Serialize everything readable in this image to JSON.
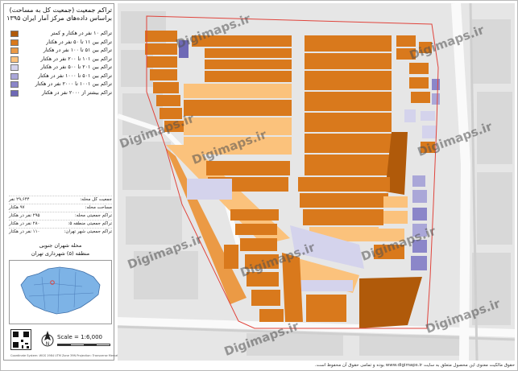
{
  "panel": {
    "title_line1": "تراکم جمعیت (جمعیت کل به مساحت)",
    "title_line2": "براساس داده‌های مرکز آمار ایران ۱۳۹۵"
  },
  "legend": [
    {
      "label": "تراکم ۱۰ نفر در هکتار و کمتر",
      "color": "#b05a0a"
    },
    {
      "label": "تراکم بین ۱۱ تا ۵۰ نفر در هکتار",
      "color": "#d9791c"
    },
    {
      "label": "تراکم بین ۵۱ تا ۱۰۰ نفر در هکتار",
      "color": "#eb9a45"
    },
    {
      "label": "تراکم بین ۱۰۱ تا ۲۰۰ نفر در هکتار",
      "color": "#fbc27c"
    },
    {
      "label": "تراکم بین ۲۰۱ تا ۵۰۰ نفر در هکتار",
      "color": "#d4d3ec"
    },
    {
      "label": "تراکم بین ۵۰۱ تا ۱۰۰۰ نفر در هکتار",
      "color": "#aaa7d8"
    },
    {
      "label": "تراکم بین ۱۰۰۱ تا ۲۰۰۰ نفر در هکتار",
      "color": "#8b86c9"
    },
    {
      "label": "تراکم بیشتر از ۲۰۰۰ نفر در هکتار",
      "color": "#6e69b6"
    }
  ],
  "stats": [
    {
      "label": "جمعیت کل محله:",
      "value": "۲۹,۶۴۴ نفر"
    },
    {
      "label": "مساحت محله:",
      "value": "۹۷ هکتار"
    },
    {
      "label": "تراکم جمعیتی محله:",
      "value": "۲۹۵ نفر در هکتار"
    },
    {
      "label": "تراکم جمعیتی منطقه ۵:",
      "value": "۲۸۰ نفر در هکتار"
    },
    {
      "label": "تراکم جمعیتی شهر تهران:",
      "value": "۱۱۰ نفر در هکتار"
    }
  ],
  "area": {
    "neighborhood": "محله شهران جنوبی",
    "district": "منطقه (۵) شهرداری تهران"
  },
  "scale": "Scale = 1:6,000",
  "footnote": "Coordinate System: WGS 1984 UTM Zone 39N   Projection: Transverse Mercator",
  "watermark": "Digimaps.ir",
  "footer": "حقوق مالکیت معنوی این محصول متعلق به سایت www.digimaps.ir بوده و تمامی حقوق آن محفوظ است.",
  "colors": {
    "road": "#f7f7f7",
    "background": "#e9e9e9",
    "boundary": "#e0443c"
  }
}
